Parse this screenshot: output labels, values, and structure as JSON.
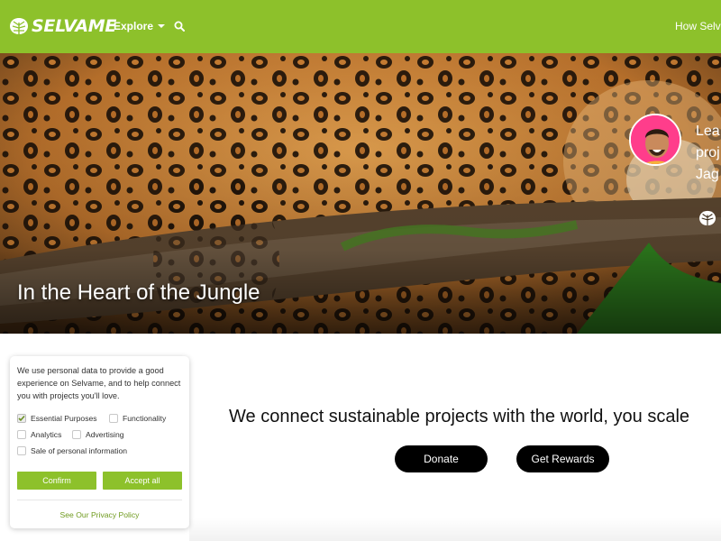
{
  "header": {
    "brand": "SELVAME",
    "logo_icon": "monstera-leaf-icon",
    "explore_label": "Explore",
    "search_icon": "search-icon",
    "how_link": "How Selva",
    "background_color": "#8dc12b"
  },
  "hero": {
    "title": "In the Heart of the Jungle",
    "story_lines": [
      "Lea",
      "proj",
      "Jag"
    ],
    "avatar_color": "#ff3d8b"
  },
  "main": {
    "tagline": "We connect sustainable projects with the world, you scale",
    "donate_label": "Donate",
    "rewards_label": "Get Rewards"
  },
  "cookie": {
    "text": "We use personal data to provide a good experience on Selvame, and to help connect you with projects you'll love.",
    "options": [
      {
        "label": "Essential Purposes",
        "checked": true
      },
      {
        "label": "Functionality",
        "checked": false
      },
      {
        "label": "Analytics",
        "checked": false
      },
      {
        "label": "Advertising",
        "checked": false
      },
      {
        "label": "Sale of personal information",
        "checked": false
      }
    ],
    "confirm_label": "Confirm",
    "accept_label": "Accept all",
    "privacy_label": "See Our Privacy Policy",
    "accent_color": "#8dc12b"
  }
}
